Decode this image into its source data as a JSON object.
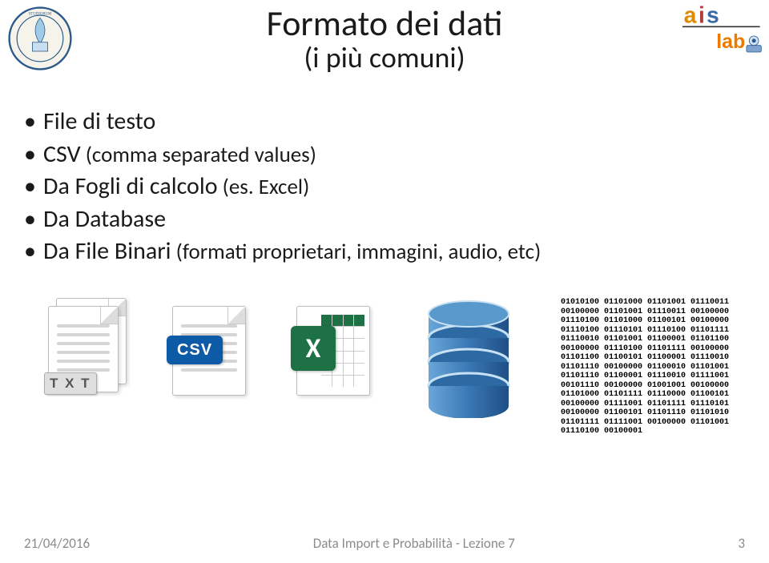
{
  "header": {
    "title": "Formato dei dati",
    "subtitle": "(i più comuni)"
  },
  "bullets": [
    {
      "text": "File di testo"
    },
    {
      "text_main": "CSV",
      "text_paren": " (comma separated values)"
    },
    {
      "text_main": "Da Fogli di calcolo",
      "text_paren": " (es. Excel)"
    },
    {
      "text": "Da Database"
    },
    {
      "text_main": "Da File Binari",
      "text_paren": " (formati proprietari, immagini, audio, etc)"
    }
  ],
  "icons": {
    "txt_label": "T X T",
    "csv_label": "CSV",
    "excel_label": "X"
  },
  "binary_lines": [
    "01010100 01101000 01101001 01110011",
    "00100000 01101001 01110011 00100000",
    "01110100 01101000 01100101 00100000",
    "01110100 01110101 01110100 01101111",
    "01110010 01101001 01100001 01101100",
    "00100000 01110100 01101111 00100000",
    "01101100 01100101 01100001 01110010",
    "01101110 00100000 01100010 01101001",
    "01101110 01100001 01110010 01111001",
    "00101110 00100000 01001001 00100000",
    "01101000 01101111 01110000 01100101",
    "00100000 01111001 01101111 01110101",
    "00100000 01100101 01101110 01101010",
    "01101111 01111001 00100000 01101001",
    "01110100 00100001"
  ],
  "footer": {
    "date": "21/04/2016",
    "center": "Data Import e Probabilità - Lezione 7",
    "page": "3"
  },
  "logos": {
    "left_alt": "Universitas Studiorum Mediolanensis",
    "right_alt": "aislab"
  }
}
